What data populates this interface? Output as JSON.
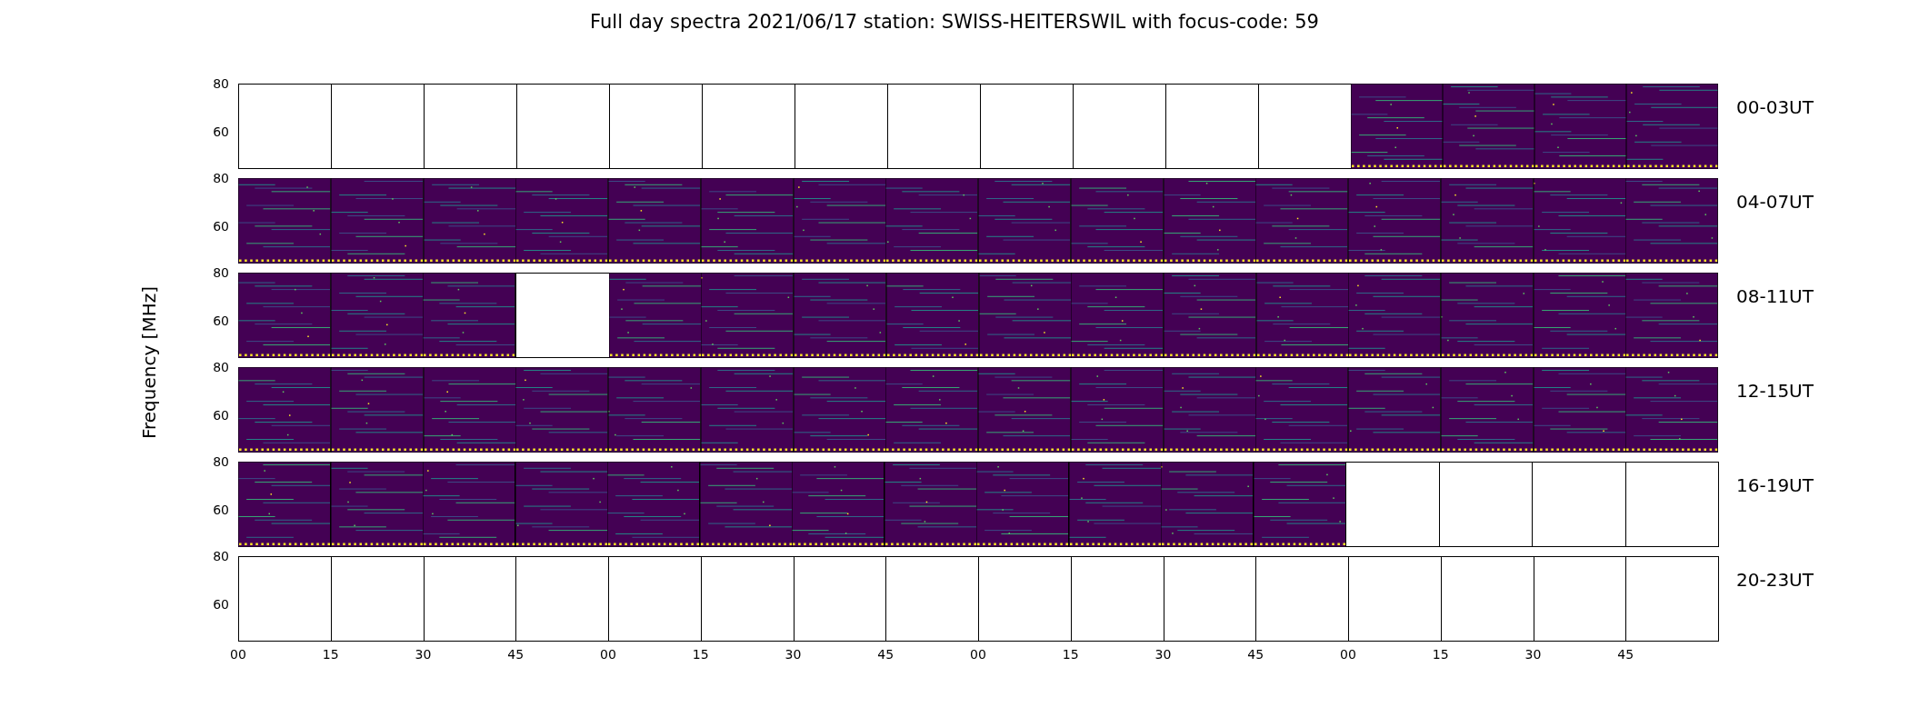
{
  "title": "Full day spectra 2021/06/17 station: SWISS-HEITERSWIL with focus-code: 59",
  "y_axis_label": "Frequency [MHz]",
  "rows": [
    {
      "label": "00-03UT",
      "y_ticks": [
        "80",
        "60"
      ],
      "panels": [
        {
          "kind": "empty"
        },
        {
          "kind": "empty"
        },
        {
          "kind": "empty"
        },
        {
          "kind": "empty"
        },
        {
          "kind": "empty"
        },
        {
          "kind": "empty"
        },
        {
          "kind": "empty"
        },
        {
          "kind": "empty"
        },
        {
          "kind": "empty"
        },
        {
          "kind": "empty"
        },
        {
          "kind": "empty"
        },
        {
          "kind": "empty"
        },
        {
          "kind": "spectrum"
        },
        {
          "kind": "spectrum"
        },
        {
          "kind": "spectrum"
        },
        {
          "kind": "spectrum"
        }
      ]
    },
    {
      "label": "04-07UT",
      "y_ticks": [
        "80",
        "60"
      ],
      "panels": [
        {
          "kind": "spectrum"
        },
        {
          "kind": "spectrum"
        },
        {
          "kind": "spectrum"
        },
        {
          "kind": "spectrum"
        },
        {
          "kind": "spectrum"
        },
        {
          "kind": "spectrum"
        },
        {
          "kind": "spectrum"
        },
        {
          "kind": "spectrum"
        },
        {
          "kind": "spectrum"
        },
        {
          "kind": "spectrum"
        },
        {
          "kind": "spectrum"
        },
        {
          "kind": "spectrum"
        },
        {
          "kind": "spectrum"
        },
        {
          "kind": "spectrum"
        },
        {
          "kind": "spectrum"
        },
        {
          "kind": "spectrum"
        }
      ]
    },
    {
      "label": "08-11UT",
      "y_ticks": [
        "80",
        "60"
      ],
      "panels": [
        {
          "kind": "spectrum"
        },
        {
          "kind": "spectrum"
        },
        {
          "kind": "spectrum"
        },
        {
          "kind": "empty"
        },
        {
          "kind": "spectrum"
        },
        {
          "kind": "spectrum"
        },
        {
          "kind": "spectrum"
        },
        {
          "kind": "spectrum"
        },
        {
          "kind": "spectrum"
        },
        {
          "kind": "spectrum"
        },
        {
          "kind": "spectrum"
        },
        {
          "kind": "spectrum"
        },
        {
          "kind": "spectrum"
        },
        {
          "kind": "spectrum"
        },
        {
          "kind": "spectrum"
        },
        {
          "kind": "spectrum"
        }
      ]
    },
    {
      "label": "12-15UT",
      "y_ticks": [
        "80",
        "60"
      ],
      "panels": [
        {
          "kind": "spectrum"
        },
        {
          "kind": "spectrum"
        },
        {
          "kind": "spectrum"
        },
        {
          "kind": "spectrum"
        },
        {
          "kind": "spectrum"
        },
        {
          "kind": "spectrum"
        },
        {
          "kind": "spectrum"
        },
        {
          "kind": "spectrum"
        },
        {
          "kind": "spectrum"
        },
        {
          "kind": "spectrum"
        },
        {
          "kind": "spectrum"
        },
        {
          "kind": "spectrum"
        },
        {
          "kind": "spectrum"
        },
        {
          "kind": "spectrum"
        },
        {
          "kind": "spectrum"
        },
        {
          "kind": "spectrum"
        }
      ]
    },
    {
      "label": "16-19UT",
      "y_ticks": [
        "80",
        "60"
      ],
      "panels": [
        {
          "kind": "spectrum"
        },
        {
          "kind": "spectrum"
        },
        {
          "kind": "spectrum"
        },
        {
          "kind": "spectrum"
        },
        {
          "kind": "spectrum"
        },
        {
          "kind": "spectrum"
        },
        {
          "kind": "spectrum"
        },
        {
          "kind": "spectrum"
        },
        {
          "kind": "spectrum"
        },
        {
          "kind": "spectrum"
        },
        {
          "kind": "spectrum"
        },
        {
          "kind": "spectrum"
        },
        {
          "kind": "empty"
        },
        {
          "kind": "empty"
        },
        {
          "kind": "empty"
        },
        {
          "kind": "empty"
        }
      ]
    },
    {
      "label": "20-23UT",
      "y_ticks": [
        "80",
        "60"
      ],
      "panels": [
        {
          "kind": "empty"
        },
        {
          "kind": "empty"
        },
        {
          "kind": "empty"
        },
        {
          "kind": "empty"
        },
        {
          "kind": "empty"
        },
        {
          "kind": "empty"
        },
        {
          "kind": "empty"
        },
        {
          "kind": "empty"
        },
        {
          "kind": "empty"
        },
        {
          "kind": "empty"
        },
        {
          "kind": "empty"
        },
        {
          "kind": "empty"
        },
        {
          "kind": "empty"
        },
        {
          "kind": "empty"
        },
        {
          "kind": "empty"
        },
        {
          "kind": "empty"
        }
      ]
    }
  ],
  "x_ticks": [
    "00",
    "15",
    "30",
    "45",
    "00",
    "15",
    "30",
    "45",
    "00",
    "15",
    "30",
    "45",
    "00",
    "15",
    "30",
    "45"
  ]
}
